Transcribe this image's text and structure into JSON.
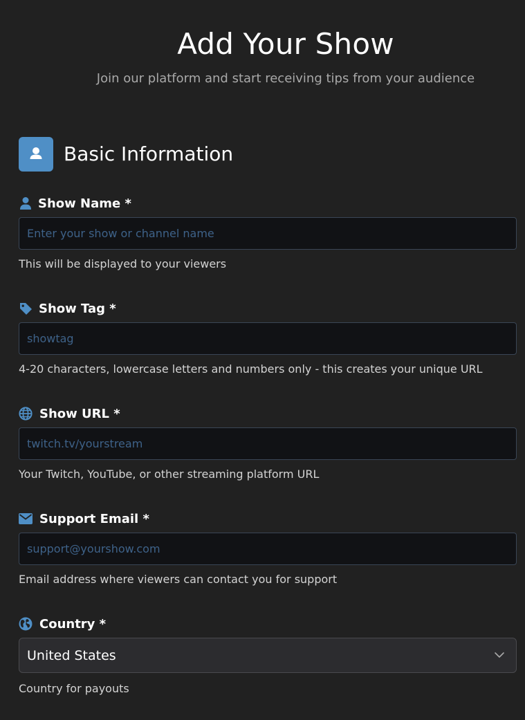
{
  "header": {
    "title": "Add Your Show",
    "subtitle": "Join our platform and start receiving tips from your audience"
  },
  "section": {
    "title": "Basic Information",
    "icon": "user-icon"
  },
  "fields": {
    "show_name": {
      "label": "Show Name *",
      "icon": "user-icon",
      "placeholder": "Enter your show or channel name",
      "help": "This will be displayed to your viewers"
    },
    "show_tag": {
      "label": "Show Tag *",
      "icon": "tag-icon",
      "placeholder": "showtag",
      "help": "4-20 characters, lowercase letters and numbers only - this creates your unique URL"
    },
    "show_url": {
      "label": "Show URL *",
      "icon": "globe-icon",
      "placeholder": "twitch.tv/yourstream",
      "help": "Your Twitch, YouTube, or other streaming platform URL"
    },
    "support_email": {
      "label": "Support Email *",
      "icon": "envelope-icon",
      "placeholder": "support@yourshow.com",
      "help": "Email address where viewers can contact you for support"
    },
    "country": {
      "label": "Country *",
      "icon": "earth-icon",
      "value": "United States",
      "help": "Country for payouts"
    }
  },
  "colors": {
    "background": "#212121",
    "accent": "#4f8fc6",
    "input_background": "#111215",
    "input_border": "#3a4656",
    "placeholder": "#3e6289"
  }
}
